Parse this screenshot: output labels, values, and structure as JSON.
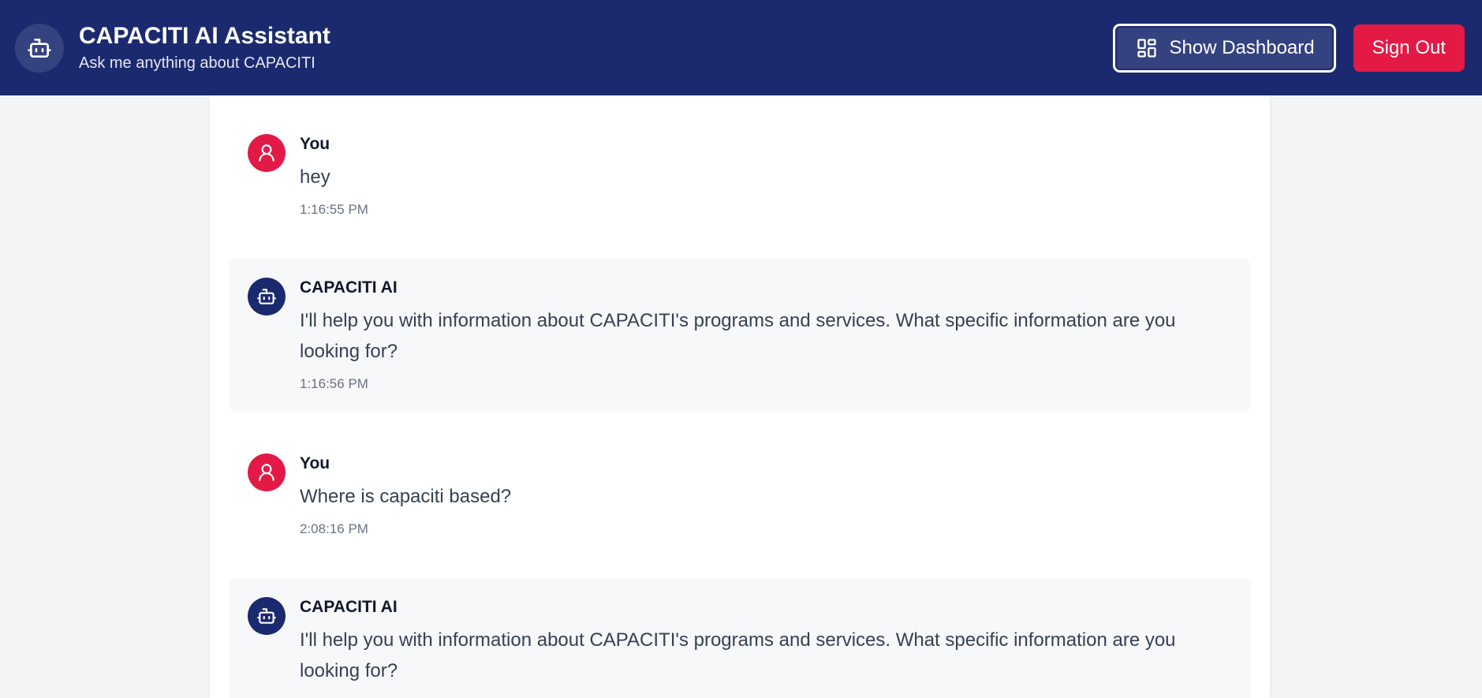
{
  "header": {
    "title": "CAPACITI AI Assistant",
    "subtitle": "Ask me anything about CAPACITI",
    "logo_icon": "robot-icon",
    "dashboard_label": "Show Dashboard",
    "dashboard_icon": "dashboard-grid-icon",
    "signout_label": "Sign Out"
  },
  "colors": {
    "header_bg": "#1b2a6e",
    "accent_red": "#e21a45",
    "ai_bubble_bg": "#f7f8fa"
  },
  "messages": [
    {
      "sender": "You",
      "text": "hey",
      "time": "1:16:55 PM",
      "role": "user",
      "icon": "user-icon"
    },
    {
      "sender": "CAPACITI AI",
      "text": "I'll help you with information about CAPACITI's programs and services. What specific information are you looking for?",
      "time": "1:16:56 PM",
      "role": "ai",
      "icon": "robot-icon"
    },
    {
      "sender": "You",
      "text": "Where is capaciti based?",
      "time": "2:08:16 PM",
      "role": "user",
      "icon": "user-icon"
    },
    {
      "sender": "CAPACITI AI",
      "text": "I'll help you with information about CAPACITI's programs and services. What specific information are you looking for?",
      "time": "",
      "role": "ai",
      "icon": "robot-icon"
    }
  ]
}
